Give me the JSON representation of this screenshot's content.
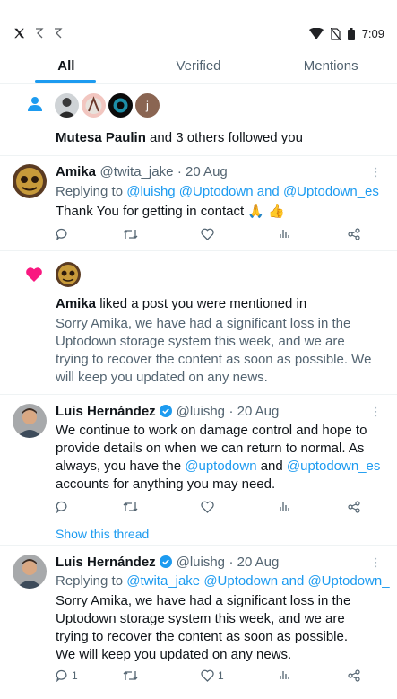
{
  "status_bar": {
    "time": "7:09"
  },
  "tabs": [
    {
      "label": "All",
      "active": true
    },
    {
      "label": "Verified",
      "active": false
    },
    {
      "label": "Mentions",
      "active": false
    }
  ],
  "follow_notification": {
    "name": "Mutesa Paulin",
    "text": " and 3 others followed you"
  },
  "tweet1": {
    "name": "Amika",
    "handle": "@twita_jake",
    "date": "· 20 Aug",
    "replying_prefix": "Replying to ",
    "replying_handles": "@luishg @Uptodown and @Uptodown_es",
    "text": "Thank You for getting in contact 🙏 👍"
  },
  "like_notification": {
    "name": "Amika",
    "text": " liked a post you were mentioned in",
    "quoted": "Sorry Amika, we have had a significant loss in the Uptodown storage system this week, and we are trying to recover the content as soon as possible. We will keep you updated on any news."
  },
  "tweet2": {
    "name": "Luis Hernández",
    "handle": "@luishg",
    "date": "· 20 Aug",
    "text_a": "We continue to work on damage control and hope to provide details on when we can return to normal. As always, you have the ",
    "link1": "@uptodown",
    "text_b": " and ",
    "link2": "@uptodown_es",
    "text_c": " accounts for anything you may need.",
    "show_thread": "Show this thread"
  },
  "tweet3": {
    "name": "Luis Hernández",
    "handle": "@luishg",
    "date": "· 20 Aug",
    "replying_prefix": "Replying to ",
    "replying_handles": "@twita_jake @Uptodown and @Uptodown_",
    "text": "Sorry Amika, we have had a significant loss in the Uptodown storage system this week, and we are trying to recover the content as soon as possible. We will keep you updated on any news.",
    "reply_count": "1",
    "like_count": "1"
  },
  "colors": {
    "accent": "#1d9bf0",
    "like": "#f91880",
    "text": "#0f1419",
    "muted": "#536471"
  },
  "icons": [
    "x-logo-icon",
    "signal-icon",
    "wifi-icon",
    "battery-icon",
    "person-icon",
    "heart-icon",
    "reply-icon",
    "retweet-icon",
    "like-icon",
    "views-icon",
    "share-icon",
    "verified-badge-icon",
    "more-icon"
  ]
}
